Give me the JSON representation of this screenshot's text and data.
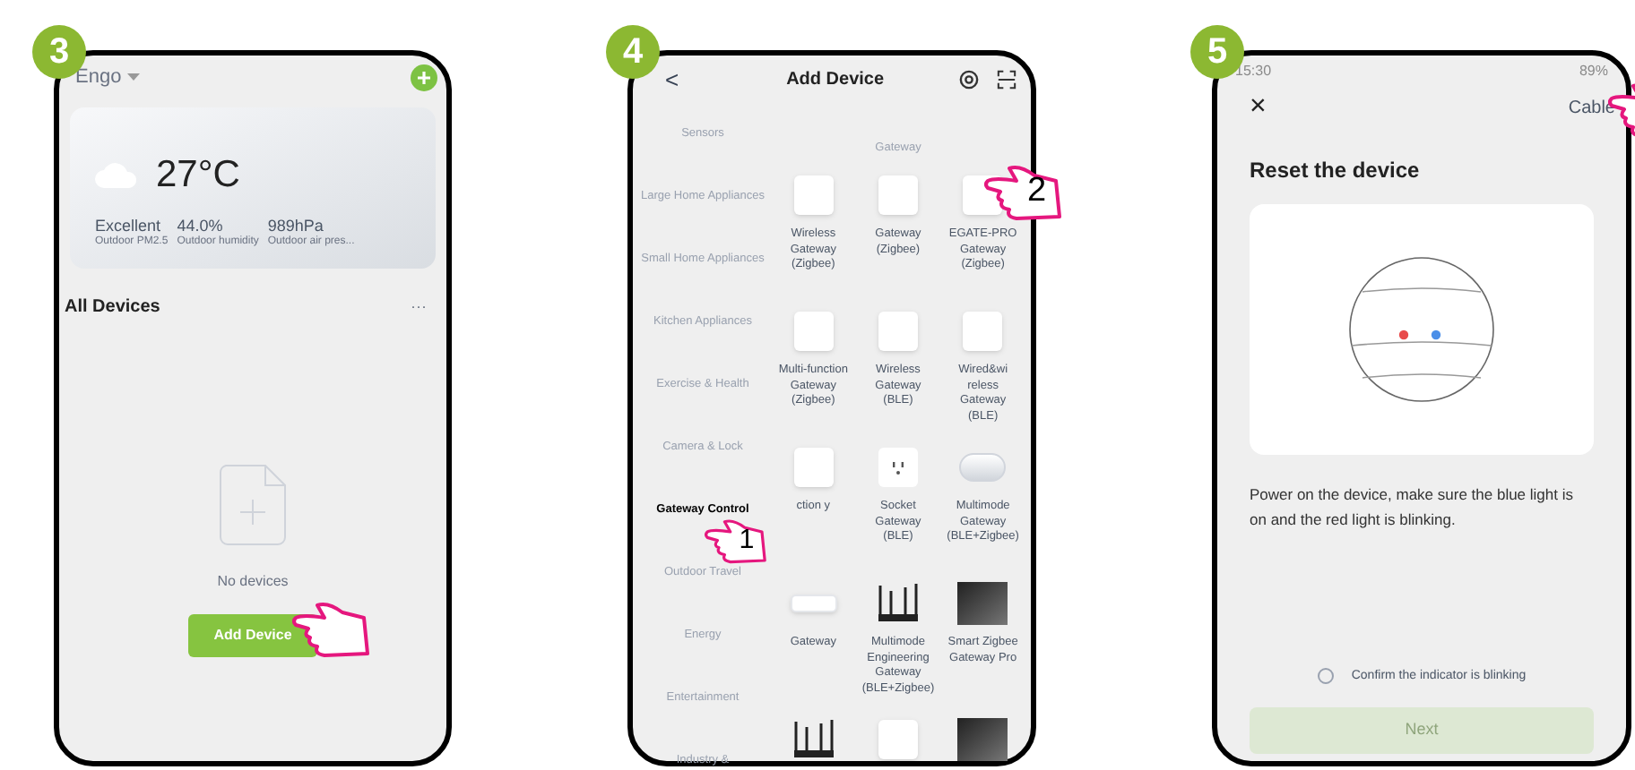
{
  "steps": [
    {
      "kind": "home",
      "badge": "3",
      "home": "Engo",
      "temperature": "27°C",
      "stats": [
        {
          "value": "Excellent",
          "label": "Outdoor PM2.5"
        },
        {
          "value": "44.0%",
          "label": "Outdoor humidity"
        },
        {
          "value": "989hPa",
          "label": "Outdoor air pres..."
        }
      ],
      "section": "All Devices",
      "more": "···",
      "empty": "No devices",
      "button": "Add Device"
    },
    {
      "kind": "catalog",
      "badge": "4",
      "back": "<",
      "title": "Add Device",
      "group": "Gateway",
      "categories": [
        {
          "label": "Sensors",
          "selected": false
        },
        {
          "label": "Large Home Appliances",
          "selected": false
        },
        {
          "label": "Small Home Appliances",
          "selected": false
        },
        {
          "label": "Kitchen Appliances",
          "selected": false
        },
        {
          "label": "Exercise & Health",
          "selected": false
        },
        {
          "label": "Camera & Lock",
          "selected": false
        },
        {
          "label": "Gateway Control",
          "selected": true
        },
        {
          "label": "Outdoor Travel",
          "selected": false
        },
        {
          "label": "Energy",
          "selected": false
        },
        {
          "label": "Entertainment",
          "selected": false
        },
        {
          "label": "Industry &",
          "selected": false
        }
      ],
      "devices": [
        {
          "name": "Wireless Gateway (Zigbee)",
          "kind": "light"
        },
        {
          "name": "Gateway (Zigbee)",
          "kind": "light"
        },
        {
          "name": "EGATE-PRO Gateway (Zigbee)",
          "kind": "light"
        },
        {
          "name": "Multi-function Gateway (Zigbee)",
          "kind": "light"
        },
        {
          "name": "Wireless Gateway (BLE)",
          "kind": "light"
        },
        {
          "name": "Wired&wi reless Gateway (BLE)",
          "kind": "light"
        },
        {
          "name": "ction y",
          "kind": "light"
        },
        {
          "name": "Socket Gateway (BLE)",
          "kind": "socket"
        },
        {
          "name": "Multimode Gateway (BLE+Zigbee)",
          "kind": "round"
        },
        {
          "name": "Gateway",
          "kind": "flat"
        },
        {
          "name": "Multimode Engineering Gateway (BLE+Zigbee)",
          "kind": "router"
        },
        {
          "name": "Smart Zigbee Gateway Pro",
          "kind": "dark"
        },
        {
          "kind": "router"
        },
        {
          "kind": "light"
        },
        {
          "kind": "dark"
        }
      ],
      "pointers": [
        {
          "label": "1"
        },
        {
          "label": "2"
        }
      ]
    },
    {
      "kind": "reset",
      "badge": "5",
      "time": "15:30",
      "battery": "89%",
      "close": "×",
      "action": "Cable",
      "title": "Reset the device",
      "description": "Power on the device, make sure the blue light is on and the red light is blinking.",
      "confirm": {
        "label": "Confirm the indicator is blinking",
        "checked": false
      },
      "next": {
        "label": "Next",
        "disabled": true
      }
    }
  ]
}
